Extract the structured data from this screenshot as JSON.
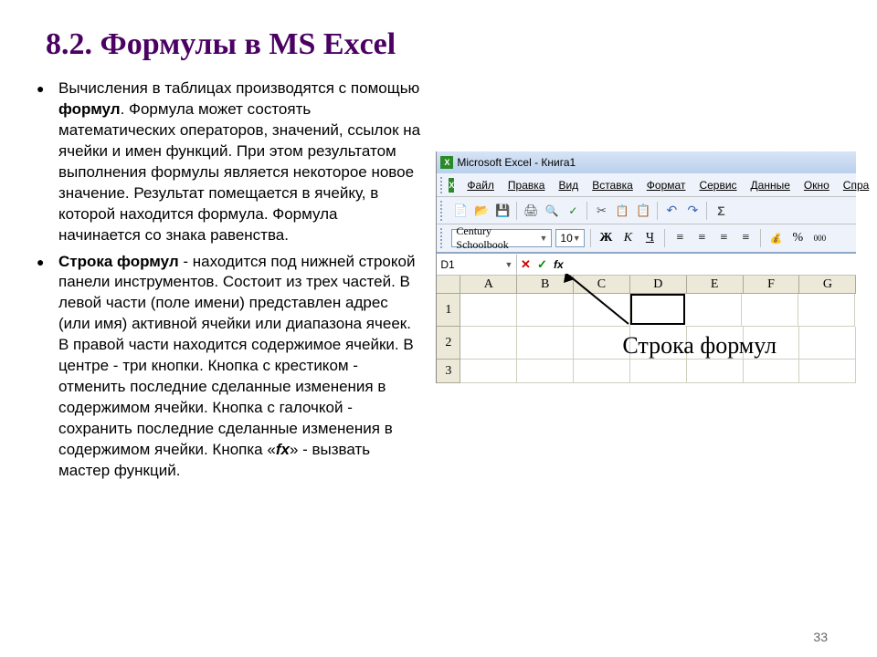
{
  "title": "8.2. Формулы в MS Excel",
  "bullets": [
    {
      "pre": "Вычисления в таблицах производятся с помощью ",
      "b1": "формул",
      "post": ". Формула может состоять математических операторов, значений, ссылок на ячейки и имен функций. При этом результатом выполнения формулы является некоторое новое значение. Результат помещается в ячейку, в которой находится формула. Формула начинается со знака равенства."
    },
    {
      "b1": "Строка формул",
      "mid": " - находится под нижней строкой панели инструментов. Состоит из трех частей. В левой части (поле имени) представлен адрес (или имя) активной ячейки или диапазона ячеек. В правой части находится содержимое ячейки. В центре - три кнопки. Кнопка с крестиком - отменить последние сделанные изменения в содержимом ячейки. Кнопка с галочкой - сохранить последние сделанные изменения в содержимом ячейки. Кнопка «",
      "bi": "fx",
      "post": "» - вызвать мастер функций."
    }
  ],
  "excel": {
    "appIcon": "X",
    "titlebar": "Microsoft Excel - Книга1",
    "winIcon": "X",
    "menu": [
      "Файл",
      "Правка",
      "Вид",
      "Вставка",
      "Формат",
      "Сервис",
      "Данные",
      "Окно",
      "Спра"
    ],
    "fontName": "Century Schoolbook",
    "fontSize": "10",
    "fmtBold": "Ж",
    "fmtItalic": "К",
    "fmtUnderline": "Ч",
    "fmtPercent": "%",
    "fmtThousand": "000",
    "nameBox": "D1",
    "fbCancel": "✕",
    "fbOk": "✓",
    "fbFx": "fx",
    "cols": [
      "A",
      "B",
      "C",
      "D",
      "E",
      "F",
      "G"
    ],
    "rows": [
      "1",
      "2",
      "3"
    ],
    "annotation": "Строка формул"
  },
  "pageNum": "33"
}
